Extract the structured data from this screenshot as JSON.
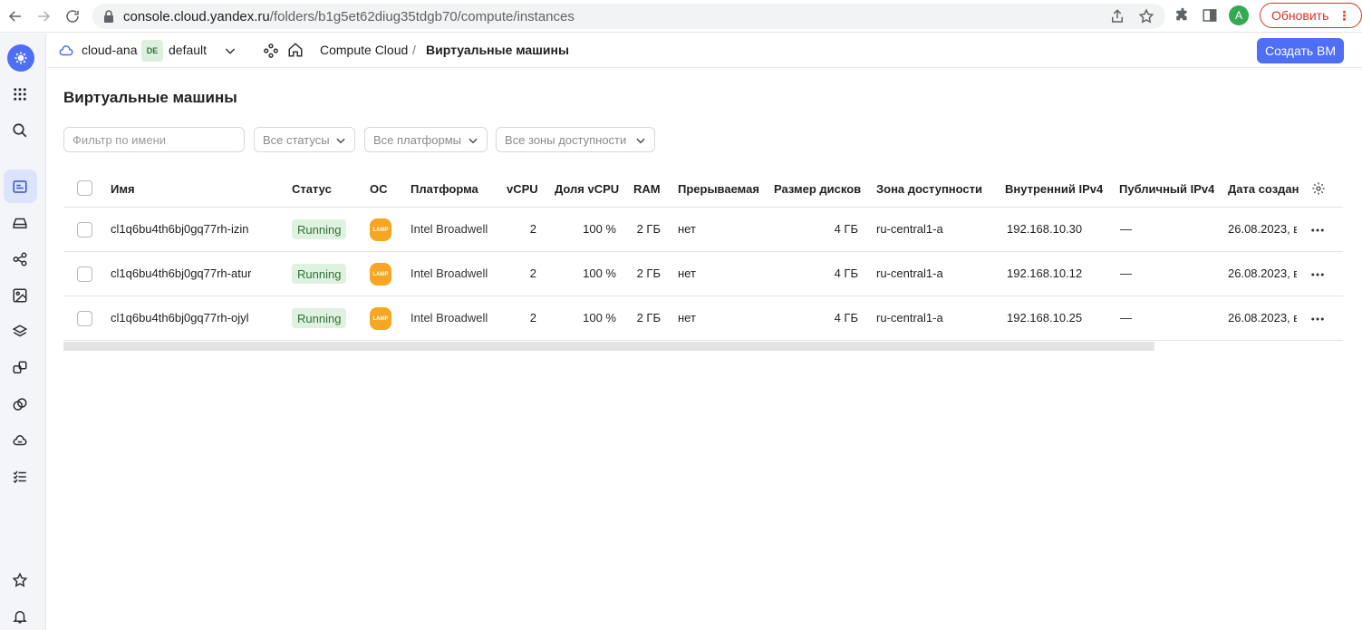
{
  "browser": {
    "url_host": "console.cloud.yandex.ru",
    "url_path": "/folders/b1g5et62diug35tdgb70/compute/instances",
    "profile_letter": "A",
    "update_label": "Обновить"
  },
  "header": {
    "cloud_name": "cloud-ana",
    "folder_badge": "DE",
    "folder_name": "default",
    "breadcrumb_service": "Compute Cloud",
    "breadcrumb_separator": "/",
    "breadcrumb_page": "Виртуальные машины",
    "create_label": "Создать ВМ"
  },
  "page": {
    "title": "Виртуальные машины",
    "filter_placeholder": "Фильтр по имени",
    "status_select": "Все статусы",
    "platform_select": "Все платформы",
    "zone_select": "Все зоны доступности"
  },
  "table": {
    "columns": {
      "name": "Имя",
      "status": "Статус",
      "os": "ОС",
      "platform": "Платформа",
      "vcpu": "vCPU",
      "vcpu_share": "Доля vCPU",
      "ram": "RAM",
      "preemptible": "Прерываемая",
      "disk_size": "Размер дисков",
      "zone": "Зона доступности",
      "internal_ip": "Внутренний IPv4",
      "public_ip": "Публичный IPv4",
      "created": "Дата создан"
    },
    "rows": [
      {
        "name": "cl1q6bu4th6bj0gq77rh-izin",
        "status": "Running",
        "os_badge": "LAMP",
        "platform": "Intel Broadwell",
        "vcpu": "2",
        "vcpu_share": "100 %",
        "ram": "2 ГБ",
        "preemptible": "нет",
        "disk_size": "4 ГБ",
        "zone": "ru-central1-a",
        "internal_ip": "192.168.10.30",
        "public_ip": "—",
        "created": "26.08.2023, в"
      },
      {
        "name": "cl1q6bu4th6bj0gq77rh-atur",
        "status": "Running",
        "os_badge": "LAMP",
        "platform": "Intel Broadwell",
        "vcpu": "2",
        "vcpu_share": "100 %",
        "ram": "2 ГБ",
        "preemptible": "нет",
        "disk_size": "4 ГБ",
        "zone": "ru-central1-a",
        "internal_ip": "192.168.10.12",
        "public_ip": "—",
        "created": "26.08.2023, в"
      },
      {
        "name": "cl1q6bu4th6bj0gq77rh-ojyl",
        "status": "Running",
        "os_badge": "LAMP",
        "platform": "Intel Broadwell",
        "vcpu": "2",
        "vcpu_share": "100 %",
        "ram": "2 ГБ",
        "preemptible": "нет",
        "disk_size": "4 ГБ",
        "zone": "ru-central1-a",
        "internal_ip": "192.168.10.25",
        "public_ip": "—",
        "created": "26.08.2023, в"
      }
    ]
  },
  "colors": {
    "accent": "#4d6ef5",
    "status_running_bg": "#dff1df",
    "status_running_text": "#307033",
    "os_badge": "#f6a623"
  }
}
